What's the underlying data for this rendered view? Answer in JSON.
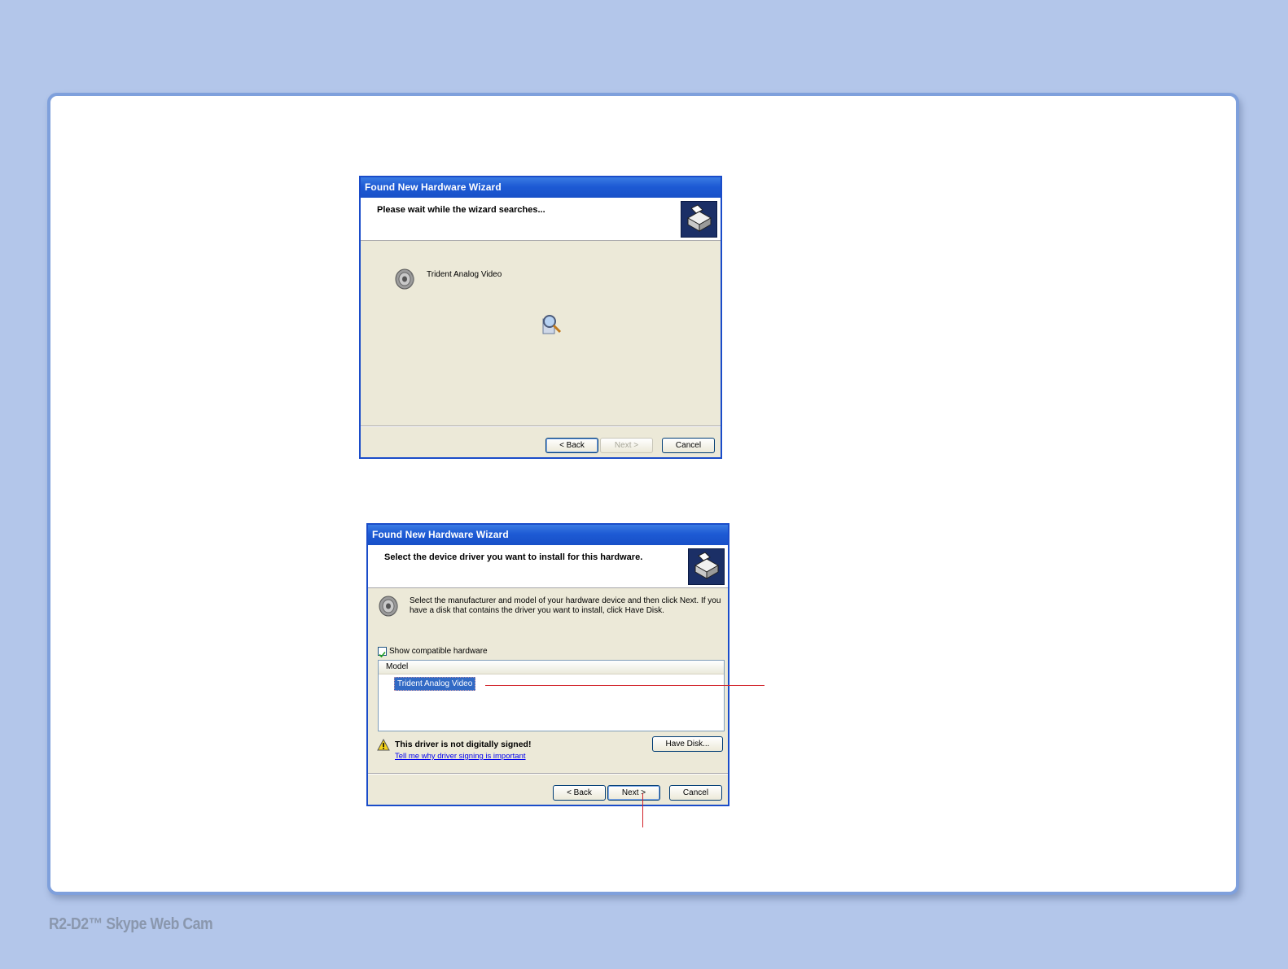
{
  "wizard1": {
    "title": "Found New Hardware Wizard",
    "header": "Please wait while the wizard searches...",
    "device_name": "Trident Analog Video",
    "buttons": {
      "back": "< Back",
      "next": "Next >",
      "cancel": "Cancel"
    }
  },
  "wizard2": {
    "title": "Found New Hardware Wizard",
    "header": "Select the device driver you want to install for this hardware.",
    "instructions_line1": "Select the manufacturer and model of your hardware device and then click Next. If you",
    "instructions_line2": "have a disk that contains the driver you want to install, click Have Disk.",
    "show_compatible_label": "Show compatible hardware",
    "show_compatible_checked": true,
    "list_column_header": "Model",
    "list_items": [
      "Trident Analog Video"
    ],
    "warning_title": "This driver is not digitally signed!",
    "warning_link": "Tell me why driver signing is important",
    "buttons": {
      "have_disk": "Have Disk...",
      "back": "< Back",
      "next": "Next >",
      "cancel": "Cancel"
    }
  },
  "footer": {
    "product_title": "R2-D2™ Skype Web Cam"
  },
  "colors": {
    "background": "#b3c6ea",
    "panel_border": "#7fa0dc",
    "titlebar": "#1d5ad4",
    "dialog_body": "#ece9d8",
    "selection": "#316ac5",
    "callout": "#d2232a"
  }
}
